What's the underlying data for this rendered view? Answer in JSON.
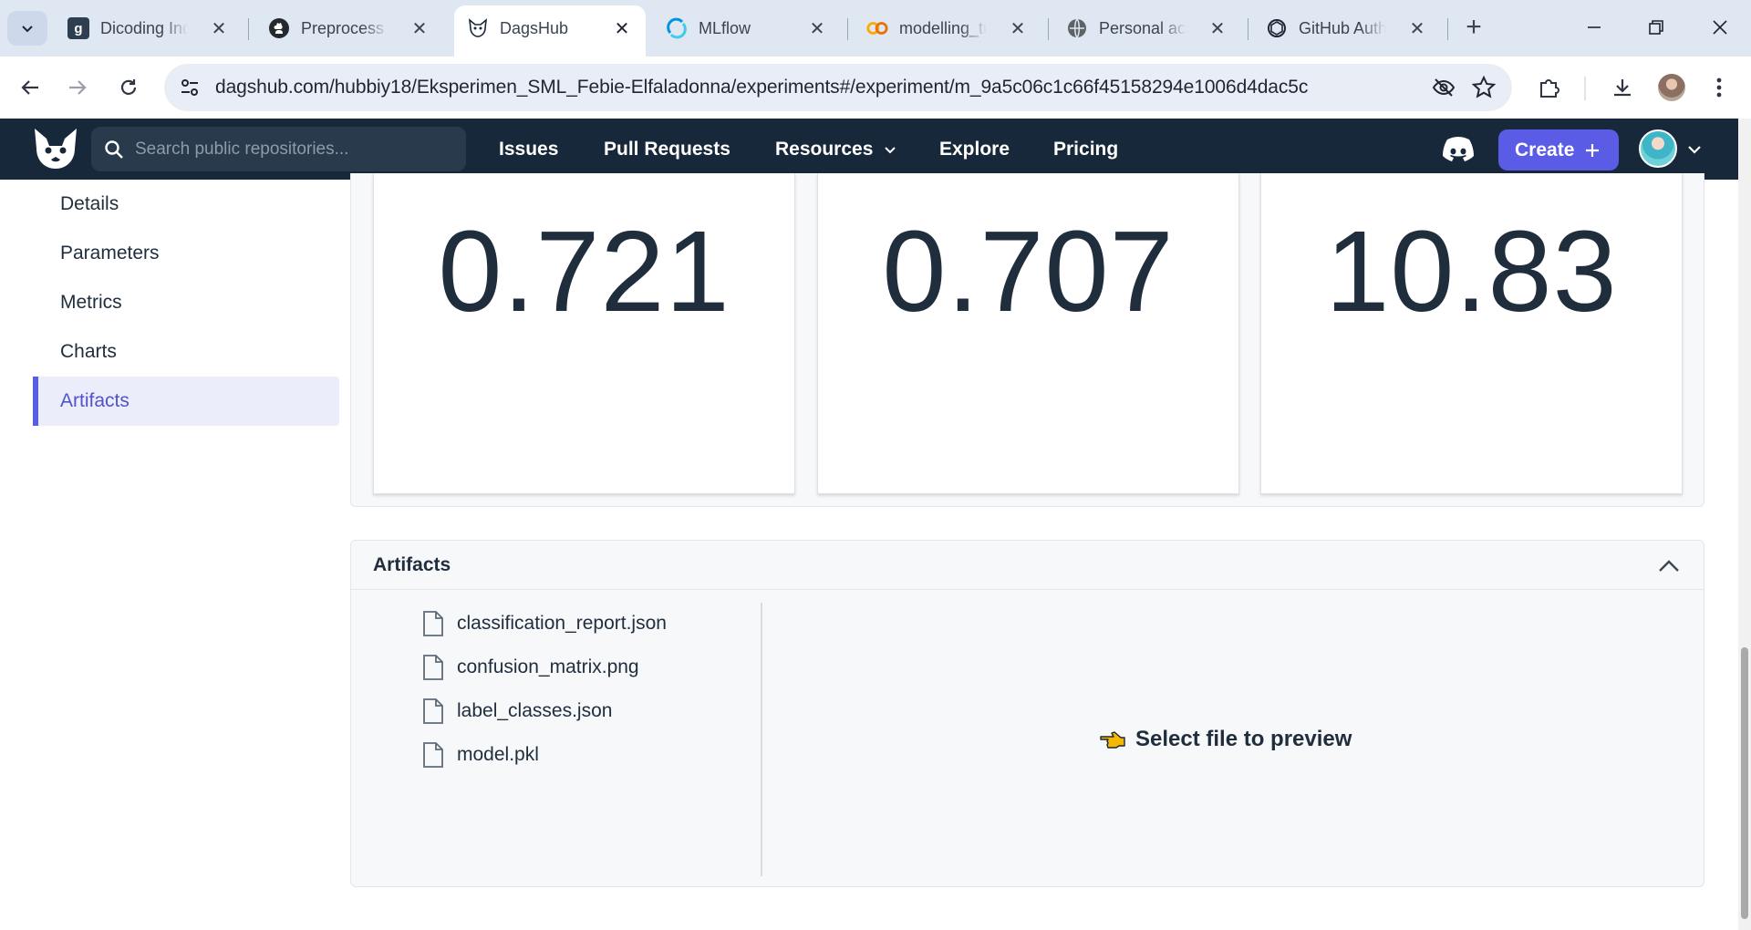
{
  "browser": {
    "tabs": [
      {
        "title": "Dicoding Indonesia",
        "favicon": "dicoding-icon"
      },
      {
        "title": "Preprocess Data",
        "favicon": "github-icon"
      },
      {
        "title": "DagsHub",
        "favicon": "dagshub-icon"
      },
      {
        "title": "MLflow",
        "favicon": "mlflow-icon"
      },
      {
        "title": "modelling_tuning",
        "favicon": "colab-icon"
      },
      {
        "title": "Personal access tokens",
        "favicon": "globe-icon"
      },
      {
        "title": "GitHub Authentication",
        "favicon": "openai-icon"
      }
    ],
    "url": "dagshub.com/hubbiy18/Eksperimen_SML_Febie-Elfaladonna/experiments#/experiment/m_9a5c06c1c66f45158294e1006d4dac5c"
  },
  "header": {
    "search_placeholder": "Search public repositories...",
    "nav": {
      "issues": "Issues",
      "pull_requests": "Pull Requests",
      "resources": "Resources",
      "explore": "Explore",
      "pricing": "Pricing"
    },
    "create_label": "Create"
  },
  "sidebar": {
    "items": [
      {
        "label": "Details"
      },
      {
        "label": "Parameters"
      },
      {
        "label": "Metrics"
      },
      {
        "label": "Charts"
      },
      {
        "label": "Artifacts"
      }
    ]
  },
  "metrics": {
    "values": [
      "0.721",
      "0.707",
      "10.83"
    ]
  },
  "artifacts": {
    "title": "Artifacts",
    "files": [
      {
        "name": "classification_report.json"
      },
      {
        "name": "confusion_matrix.png"
      },
      {
        "name": "label_classes.json"
      },
      {
        "name": "model.pkl"
      }
    ],
    "preview_message": "Select file to preview"
  },
  "colors": {
    "header_bg": "#17283a",
    "accent": "#5b5ce6",
    "tabstrip_bg": "#dfe7f3"
  }
}
